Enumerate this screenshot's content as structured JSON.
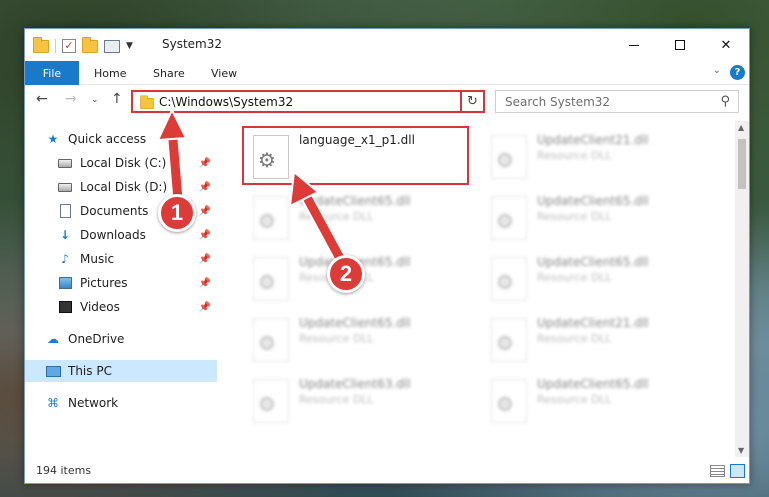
{
  "window": {
    "title": "System32",
    "min_symbol": "",
    "close_symbol": "✕"
  },
  "ribbon": {
    "tabs": [
      "File",
      "Home",
      "Share",
      "View"
    ],
    "help": "?"
  },
  "address": {
    "path": "C:\\Windows\\System32",
    "refresh": "↻",
    "search_placeholder": "Search System32"
  },
  "nav": {
    "items": [
      {
        "label": "Quick access",
        "icon": "star-icon"
      },
      {
        "label": "Local Disk (C:)",
        "icon": "disk-icon",
        "pinned": true
      },
      {
        "label": "Local Disk (D:)",
        "icon": "disk-icon",
        "pinned": true
      },
      {
        "label": "Documents",
        "icon": "document-icon",
        "pinned": true
      },
      {
        "label": "Downloads",
        "icon": "download-icon",
        "pinned": true
      },
      {
        "label": "Music",
        "icon": "music-icon",
        "pinned": true
      },
      {
        "label": "Pictures",
        "icon": "pictures-icon",
        "pinned": true
      },
      {
        "label": "Videos",
        "icon": "videos-icon",
        "pinned": true
      },
      {
        "label": "OneDrive",
        "icon": "cloud-icon"
      },
      {
        "label": "This PC",
        "icon": "computer-icon",
        "selected": true
      },
      {
        "label": "Network",
        "icon": "network-icon"
      }
    ]
  },
  "files": [
    {
      "name": "language_x1_p1.dll",
      "type": ""
    },
    {
      "name": "UpdateClient21.dll",
      "type": "Resource DLL"
    },
    {
      "name": "UpdateClient65.dll",
      "type": "Resource DLL"
    },
    {
      "name": "UpdateClient65.dll",
      "type": "Resource DLL"
    },
    {
      "name": "UpdateClient65.dll",
      "type": "Resource DLL"
    },
    {
      "name": "UpdateClient65.dll",
      "type": "Resource DLL"
    },
    {
      "name": "UpdateClient65.dll",
      "type": "Resource DLL"
    },
    {
      "name": "UpdateClient21.dll",
      "type": "Resource DLL"
    },
    {
      "name": "UpdateClient63.dll",
      "type": "Resource DLL"
    },
    {
      "name": "UpdateClient65.dll",
      "type": "Resource DLL"
    }
  ],
  "status": {
    "item_count": "194 items"
  },
  "annotations": {
    "step1": "1",
    "step2": "2",
    "color": "#dd3b37"
  }
}
